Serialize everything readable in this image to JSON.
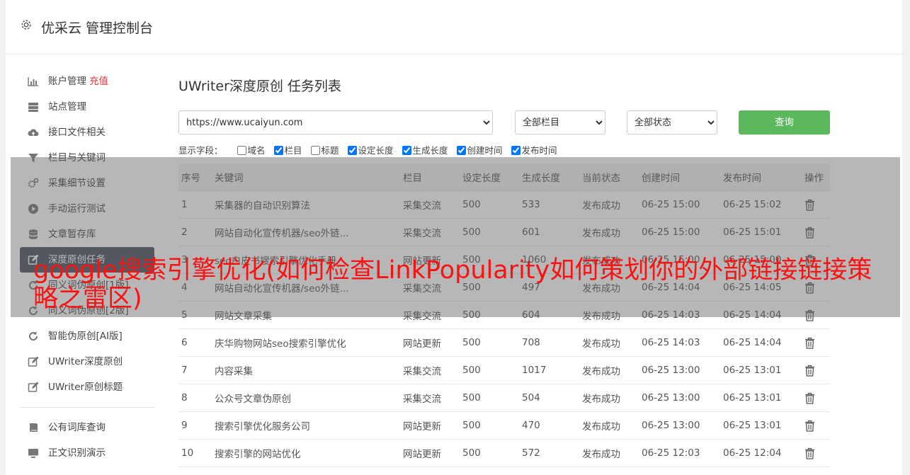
{
  "header": {
    "title": "优采云 管理控制台"
  },
  "sidebar": {
    "items": [
      {
        "label": "账户管理",
        "badge": "充值",
        "icon": "bar-chart-icon"
      },
      {
        "label": "站点管理",
        "icon": "server-icon"
      },
      {
        "label": "接口文件相关",
        "icon": "cloud-upload-icon"
      },
      {
        "label": "栏目与关键词",
        "icon": "filter-icon"
      },
      {
        "label": "采集细节设置",
        "icon": "cogs-icon"
      },
      {
        "label": "手动运行测试",
        "icon": "play-circle-icon"
      },
      {
        "label": "文章暂存库",
        "icon": "database-icon"
      },
      {
        "label": "深度原创任务",
        "icon": "edit-icon",
        "active": true
      },
      {
        "label": "同义词伪原创[1版]",
        "icon": "refresh-icon"
      },
      {
        "label": "同义词伪原创[2版]",
        "icon": "refresh-icon"
      },
      {
        "label": "智能伪原创[AI版]",
        "icon": "refresh-icon"
      },
      {
        "label": "UWriter深度原创",
        "icon": "edit-icon"
      },
      {
        "label": "UWriter原创标题",
        "icon": "edit-icon"
      },
      {
        "label": "公有词库查询",
        "icon": "book-icon"
      },
      {
        "label": "正文识别演示",
        "icon": "monitor-icon"
      }
    ]
  },
  "page": {
    "title": "UWriter深度原创 任务列表",
    "site_select": "https://www.ucaiyun.com",
    "column_select": "全部栏目",
    "status_select": "全部状态",
    "query_button": "查询",
    "fields_label": "显示字段：",
    "fields": [
      {
        "label": "域名",
        "checked": false
      },
      {
        "label": "栏目",
        "checked": true
      },
      {
        "label": "标题",
        "checked": false
      },
      {
        "label": "设定长度",
        "checked": true
      },
      {
        "label": "生成长度",
        "checked": true
      },
      {
        "label": "创建时间",
        "checked": true
      },
      {
        "label": "发布时间",
        "checked": true
      }
    ]
  },
  "table": {
    "headers": [
      "序号",
      "关键词",
      "栏目",
      "设定长度",
      "生成长度",
      "当前状态",
      "创建时间",
      "发布时间",
      "操作"
    ],
    "rows": [
      [
        "1",
        "采集器的自动识别算法",
        "采集交流",
        "500",
        "533",
        "发布成功",
        "06-25 15:00",
        "06-25 15:02"
      ],
      [
        "2",
        "网站自动化宣传机器/seo外链...",
        "采集交流",
        "500",
        "601",
        "发布成功",
        "06-25 15:00",
        "06-25 15:01"
      ],
      [
        "3",
        "seo白皮书搜索引擎优化手册",
        "网站更新",
        "500",
        "1060",
        "发布成功",
        "06-25 15:00",
        "06-25 15:00"
      ],
      [
        "4",
        "网站自动化宣传机器/seo外链...",
        "采集交流",
        "500",
        "497",
        "发布成功",
        "06-25 14:04",
        "06-25 14:05"
      ],
      [
        "5",
        "网站文章采集",
        "采集交流",
        "500",
        "604",
        "发布成功",
        "06-25 14:03",
        "06-25 14:04"
      ],
      [
        "6",
        "庆华购物网站seo搜索引擎优化",
        "网站更新",
        "500",
        "708",
        "发布成功",
        "06-25 14:03",
        "06-25 14:04"
      ],
      [
        "7",
        "内容采集",
        "采集交流",
        "500",
        "1017",
        "发布成功",
        "06-25 13:00",
        "06-25 13:01"
      ],
      [
        "8",
        "公众号文章伪原创",
        "采集交流",
        "500",
        "504",
        "发布成功",
        "06-25 13:00",
        "06-25 13:01"
      ],
      [
        "9",
        "搜索引擎优化服务公司",
        "网站更新",
        "500",
        "470",
        "发布成功",
        "06-25 13:00",
        "06-25 13:01"
      ],
      [
        "10",
        "搜索引擎的网站优化",
        "网站更新",
        "500",
        "572",
        "发布成功",
        "06-25 12:03",
        "06-25 12:04"
      ]
    ]
  },
  "overlay": {
    "headline": "google搜索引擎优化(如何检查LinkPopularity如何策划你的外部链接链接策略之雷区)"
  },
  "colors": {
    "accent_green": "#5cb85c",
    "active_nav": "#4a5361",
    "headline_red": "#ff1010",
    "status_ok": "#2e9a2e"
  }
}
